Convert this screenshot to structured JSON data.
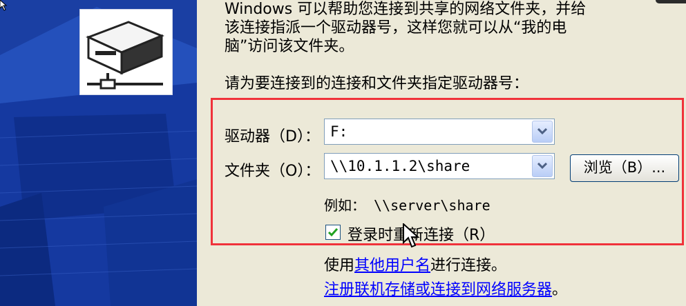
{
  "intro": {
    "line1": "Windows 可以帮助您连接到共享的网络文件夹，并给",
    "line2": "该连接指派一个驱动器号，这样您就可以从“我的电",
    "line3": "脑”访问该文件夹。"
  },
  "prompt": "请为要连接到的连接和文件夹指定驱动器号：",
  "drive": {
    "label": "驱动器（D）：",
    "value": "F:"
  },
  "folder": {
    "label": "文件夹（O）：",
    "value": "\\\\10.1.1.2\\share"
  },
  "browse_label": "浏览（B）...",
  "example": "例如： \\\\server\\share",
  "reconnect": {
    "label": "登录时重新连接（R）",
    "checked": true
  },
  "other_user": {
    "prefix": "使用",
    "link": "其他用户名",
    "suffix": "进行连接。"
  },
  "register_link": "注册联机存储或连接到网络服务器",
  "register_suffix": "。",
  "colors": {
    "side_blue": "#1a3fa3",
    "dialog_bg": "#ece9d8",
    "highlight_red": "#f0323a",
    "link_blue": "#0000ff"
  },
  "icons": [
    "network-drive-icon",
    "dropdown-arrow-icon",
    "checkmark-icon",
    "mouse-cursor-icon"
  ]
}
